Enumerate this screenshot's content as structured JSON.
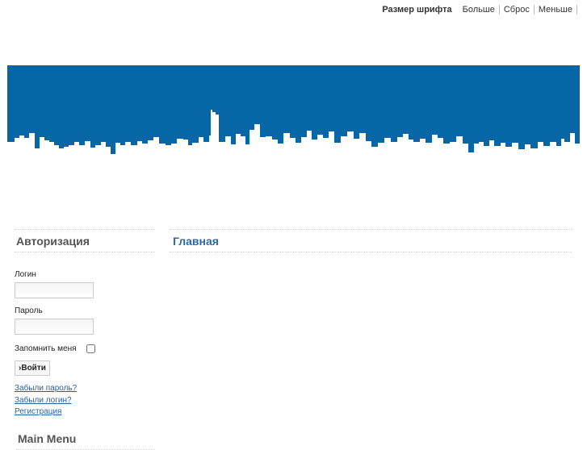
{
  "font_bar": {
    "label": "Размер шрифта",
    "bigger": "Больше",
    "reset": "Сброс",
    "smaller": "Меньше"
  },
  "colors": {
    "banner_blue": "#0766a6",
    "title_blue": "#2d6aa4",
    "link_blue": "#2a5fa0"
  },
  "login": {
    "title": "Авторизация",
    "username_label": "Логин",
    "username_value": "",
    "password_label": "Пароль",
    "password_value": "",
    "remember_label": "Запомнить меня",
    "remember_checked": false,
    "submit_label": "Войти",
    "links": {
      "forgot_password": "Забыли пароль?",
      "forgot_login": "Забыли логин?",
      "register": "Регистрация"
    }
  },
  "main_menu": {
    "title": "Main Menu"
  },
  "main": {
    "title": "Главная"
  }
}
